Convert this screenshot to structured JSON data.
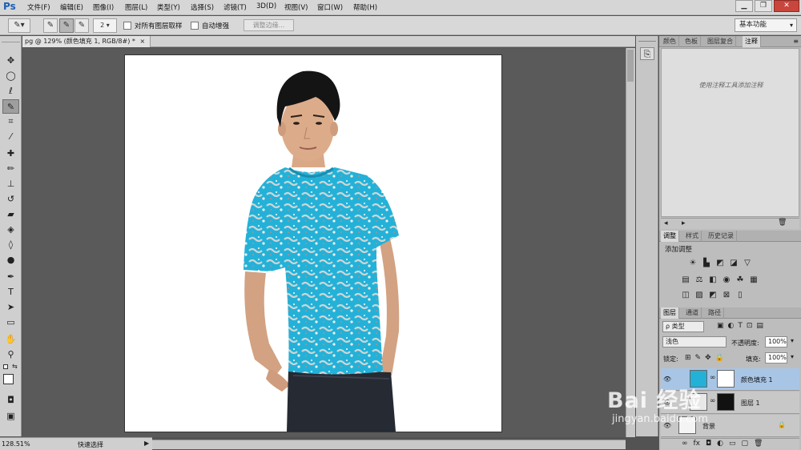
{
  "app": {
    "logo": "Ps"
  },
  "menu": [
    "文件(F)",
    "编辑(E)",
    "图像(I)",
    "图层(L)",
    "类型(Y)",
    "选择(S)",
    "滤镜(T)",
    "3D(D)",
    "视图(V)",
    "窗口(W)",
    "帮助(H)"
  ],
  "window_controls": {
    "minimize": "▁",
    "restore": "❐",
    "close": "✕"
  },
  "options": {
    "brush_size": "2",
    "sample_all_layers": "对所有图层取样",
    "auto_enhance": "自动增强",
    "refine_edge": "调整边缘...",
    "workspace": "基本功能"
  },
  "document": {
    "tab_title": "pg @ 129% (颜色填充 1, RGB/8#) *",
    "close": "×"
  },
  "status": {
    "zoom": "128.51%",
    "tool_name": "快速选择"
  },
  "panels": {
    "top_tabs": [
      "颜色",
      "色板",
      "图层复合",
      "注释"
    ],
    "notes_hint": "使用注释工具添加注释",
    "adjust_tabs": [
      "调整",
      "样式",
      "历史记录"
    ],
    "adjust_title": "添加调整",
    "layers_tabs": [
      "图层",
      "通道",
      "路径"
    ],
    "filter_kind": "ρ 类型",
    "blend_mode": "浅色",
    "opacity_label": "不透明度:",
    "opacity_value": "100%",
    "lock_label": "锁定:",
    "fill_label": "填充:",
    "fill_value": "100%"
  },
  "layers": [
    {
      "name": "颜色填充 1",
      "selected": true
    },
    {
      "name": "图层 1",
      "selected": false
    },
    {
      "name": "背景",
      "selected": false
    }
  ],
  "watermark": {
    "brand": "Bai 经验",
    "url": "jingyan.baidu.com"
  },
  "colors": {
    "shirt": "#24b1d8",
    "ps_blue": "#1c5fb3",
    "selected_layer": "#a9c5e6"
  }
}
